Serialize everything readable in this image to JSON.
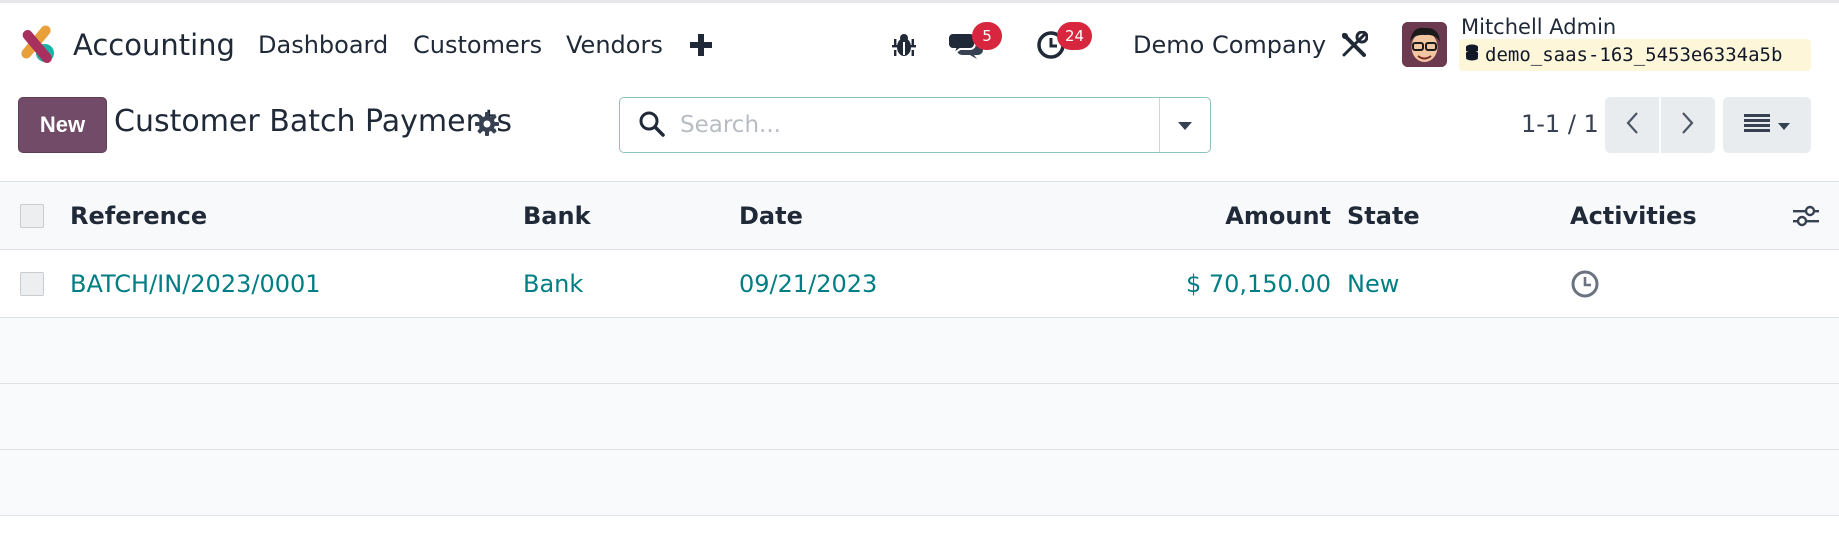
{
  "navbar": {
    "app_name": "Accounting",
    "menu": [
      "Dashboard",
      "Customers",
      "Vendors"
    ],
    "messages_badge": "5",
    "activities_badge": "24",
    "company": "Demo Company",
    "user_name": "Mitchell Admin",
    "database": "demo_saas-163_5453e6334a5b"
  },
  "control_panel": {
    "new_label": "New",
    "title": "Customer Batch Payments",
    "search_placeholder": "Search...",
    "pager": "1-1 / 1"
  },
  "table": {
    "columns": [
      "Reference",
      "Bank",
      "Date",
      "Amount",
      "State",
      "Activities"
    ],
    "rows": [
      {
        "reference": "BATCH/IN/2023/0001",
        "bank": "Bank",
        "date": "09/21/2023",
        "amount": "$ 70,150.00",
        "state": "New"
      }
    ]
  },
  "colors": {
    "brand": "#714b67",
    "link": "#017e84",
    "badge": "#d7263d"
  }
}
